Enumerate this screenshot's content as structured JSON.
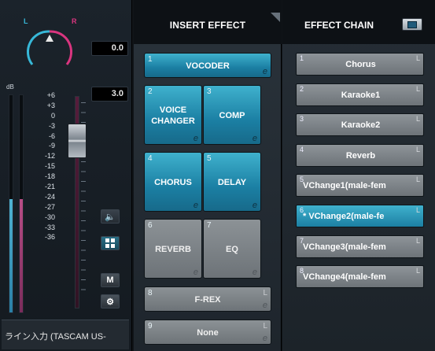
{
  "mixer": {
    "pan_left_label": "L",
    "pan_right_label": "R",
    "pan_value": "0.0",
    "gain_value": "3.0",
    "db_label": "dB",
    "scale": [
      "+6",
      "+3",
      "0",
      "-3",
      "-6",
      "-9",
      "-12",
      "-15",
      "-18",
      "-21",
      "-24",
      "-27",
      "-30",
      "-33",
      "-36"
    ],
    "left_meter_level": 0.52,
    "right_meter_level": 0.52,
    "m_label": "M",
    "device_label": "ライン入力 (TASCAM US-"
  },
  "insert_effect": {
    "title": "INSERT EFFECT",
    "slots": [
      {
        "num": "1",
        "name": "VOCODER",
        "active": true
      },
      {
        "num": "2",
        "name": "VOICE CHANGER",
        "active": true
      },
      {
        "num": "3",
        "name": "COMP",
        "active": true
      },
      {
        "num": "4",
        "name": "CHORUS",
        "active": true
      },
      {
        "num": "5",
        "name": "DELAY",
        "active": true
      },
      {
        "num": "6",
        "name": "REVERB",
        "active": false
      },
      {
        "num": "7",
        "name": "EQ",
        "active": false
      },
      {
        "num": "8",
        "name": "F-REX",
        "active": false
      },
      {
        "num": "9",
        "name": "None",
        "active": false
      }
    ],
    "edit_mark": "e",
    "lock_mark": "L"
  },
  "effect_chain": {
    "title": "EFFECT CHAIN",
    "items": [
      {
        "num": "1",
        "name": "Chorus"
      },
      {
        "num": "2",
        "name": "Karaoke1"
      },
      {
        "num": "3",
        "name": "Karaoke2"
      },
      {
        "num": "4",
        "name": "Reverb"
      },
      {
        "num": "5",
        "name": "VChange1(male-fem"
      },
      {
        "num": "6",
        "name": "* VChange2(male-fe"
      },
      {
        "num": "7",
        "name": "VChange3(male-fem"
      },
      {
        "num": "8",
        "name": "VChange4(male-fem"
      }
    ],
    "selected_index": 5,
    "lock_mark": "L"
  },
  "colors": {
    "active_blue": "#1b7fa3",
    "inactive_gray": "#6d7378",
    "pan_left": "#37b8d8",
    "pan_right": "#d9357f"
  }
}
